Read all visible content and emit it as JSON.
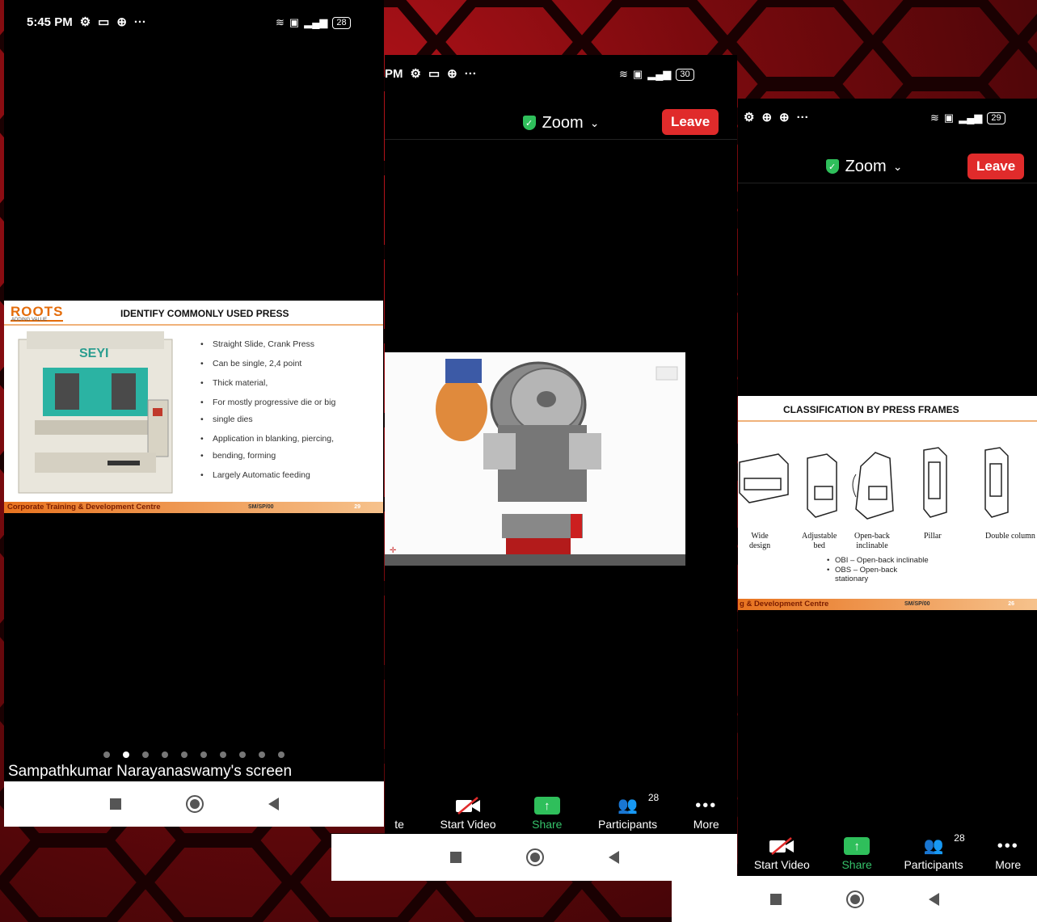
{
  "phone1": {
    "status": {
      "time": "5:45 PM",
      "more": "···",
      "battery": "28"
    },
    "slide": {
      "logo": "ROOTS",
      "logo_sub": "ADDING VALUE",
      "title": "IDENTIFY COMMONLY USED PRESS",
      "machine_brand": "SEYI",
      "bullets": [
        "Straight Slide, Crank Press",
        "Can be single, 2,4 point",
        "Thick material,",
        "For mostly progressive die or big",
        "single dies",
        "Application in blanking, piercing,",
        "bending, forming",
        "Largely Automatic feeding"
      ],
      "footer_left": "Corporate Training & Development Centre",
      "footer_mid": "SM/SP/00",
      "footer_right": "29"
    },
    "pager": {
      "count": 10,
      "active": 1
    },
    "screen_label": "Sampathkumar Narayanaswamy's screen"
  },
  "phone2": {
    "status": {
      "time": "PM",
      "more": "···",
      "battery": "30"
    },
    "meeting_title": "Zoom",
    "leave_label": "Leave",
    "toolbar": [
      {
        "label": "te"
      },
      {
        "label": "Start Video"
      },
      {
        "label": "Share"
      },
      {
        "label": "Participants",
        "count": "28"
      },
      {
        "label": "More"
      }
    ]
  },
  "phone3": {
    "status": {
      "more": "···",
      "battery": "29"
    },
    "meeting_title": "Zoom",
    "leave_label": "Leave",
    "slide": {
      "title": "CLASSIFICATION BY PRESS FRAMES",
      "frame_labels": [
        "Wide\ndesign",
        "Adjustable\nbed",
        "Open-back\ninclinable",
        "Pillar",
        "Double column"
      ],
      "notes": [
        "OBI – Open-back inclinable",
        "OBS – Open-back stationary"
      ],
      "footer_left": "g & Development Centre",
      "footer_mid": "SM/SP/00",
      "footer_right": "26"
    },
    "toolbar": [
      {
        "label": "Start Video"
      },
      {
        "label": "Share"
      },
      {
        "label": "Participants",
        "count": "28"
      },
      {
        "label": "More"
      }
    ]
  },
  "colors": {
    "leave": "#e02b2b",
    "share": "#2fbf5b",
    "accent": "#e46c0a"
  }
}
